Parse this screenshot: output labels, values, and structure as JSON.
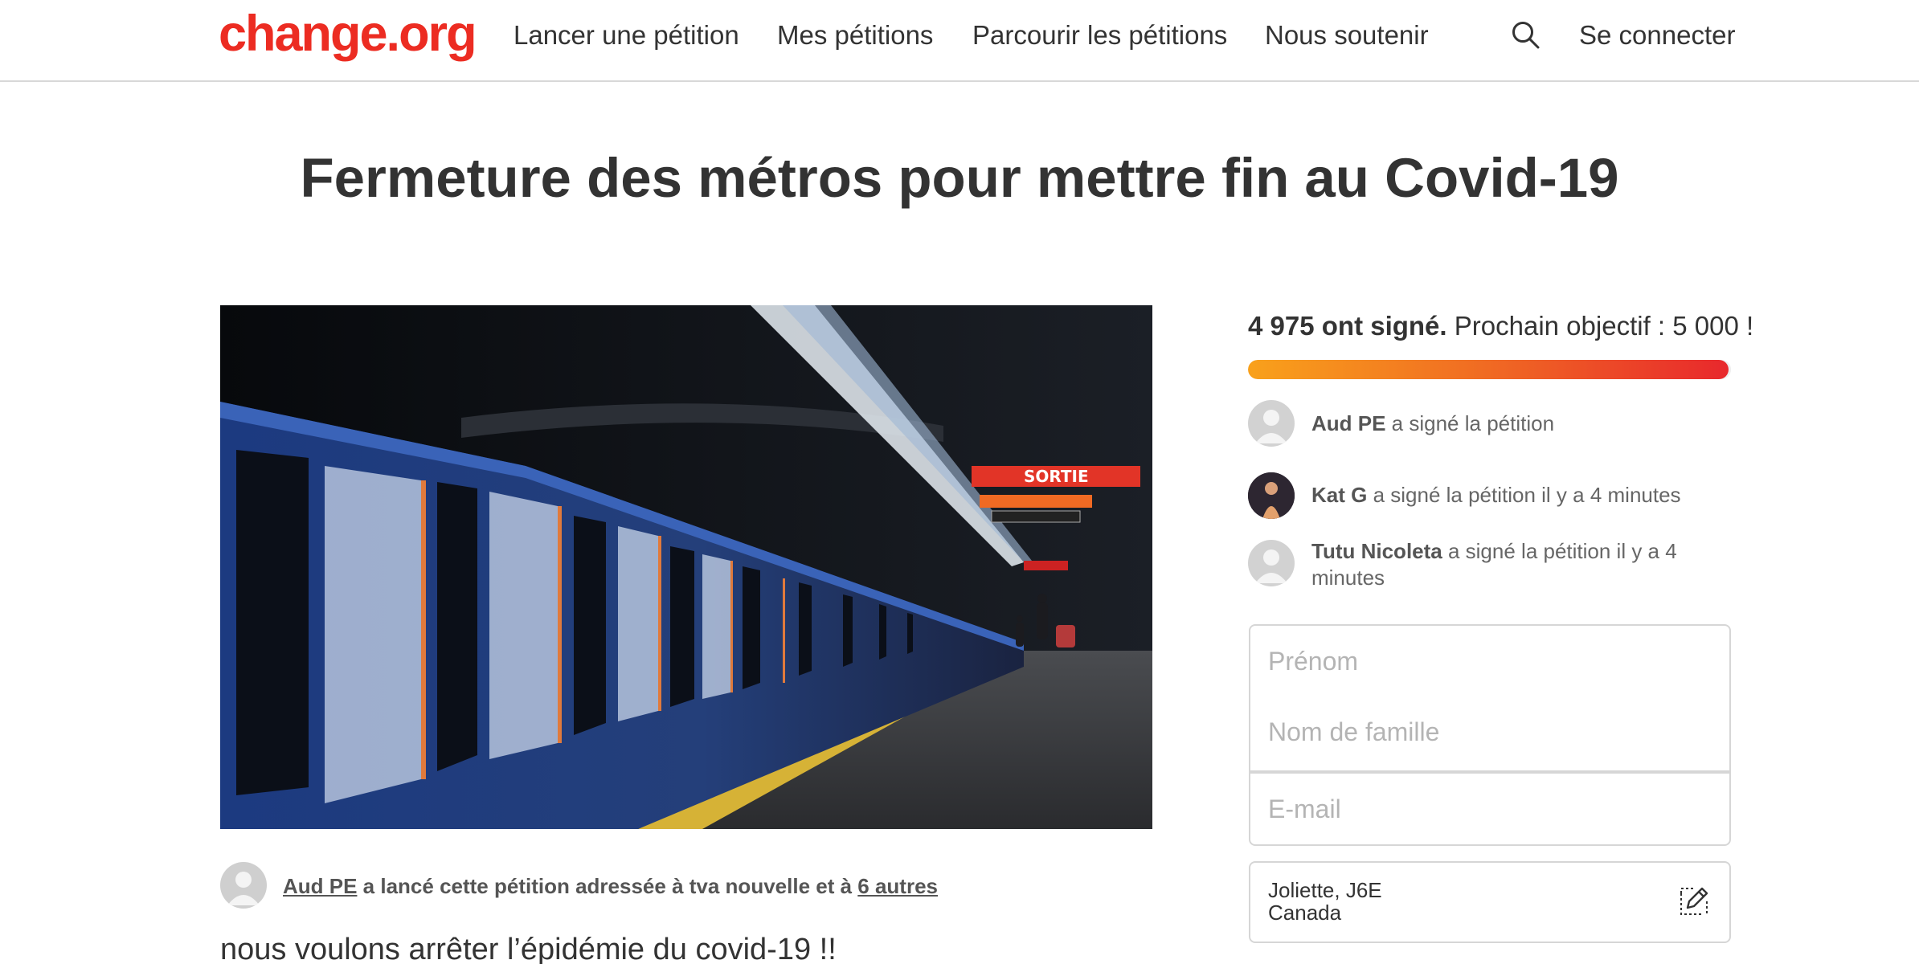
{
  "header": {
    "logo": "change.org",
    "nav": [
      "Lancer une pétition",
      "Mes pétitions",
      "Parcourir les pétitions",
      "Nous soutenir"
    ],
    "login": "Se connecter"
  },
  "petition": {
    "title": "Fermeture des métros pour mettre fin au Covid-19",
    "author_name": "Aud PE",
    "author_mid": " a lancé cette pétition adressée à tva nouvelle et à ",
    "others": "6 autres",
    "body_start": "nous voulons arrêter l’épidémie du covid-19 !!"
  },
  "signatures": {
    "count_text": "4 975 ont signé.",
    "goal_text": " Prochain objectif : 5 000 !",
    "progress": 0.995
  },
  "recent_signers": [
    {
      "name": "Aud PE",
      "action": " a signé la pétition"
    },
    {
      "name": "Kat G",
      "action": " a signé la pétition il y a 4 minutes"
    },
    {
      "name": "Tutu Nicoleta",
      "action": " a signé la pétition il y a 4 minutes"
    }
  ],
  "form": {
    "first_name_placeholder": "Prénom",
    "last_name_placeholder": "Nom de famille",
    "email_placeholder": "E-mail",
    "location_line1": "Joliette, J6E",
    "location_line2": "Canada"
  },
  "colors": {
    "brand": "#ec2c22",
    "progress_start": "#f9a11b",
    "progress_end": "#e8282c"
  }
}
